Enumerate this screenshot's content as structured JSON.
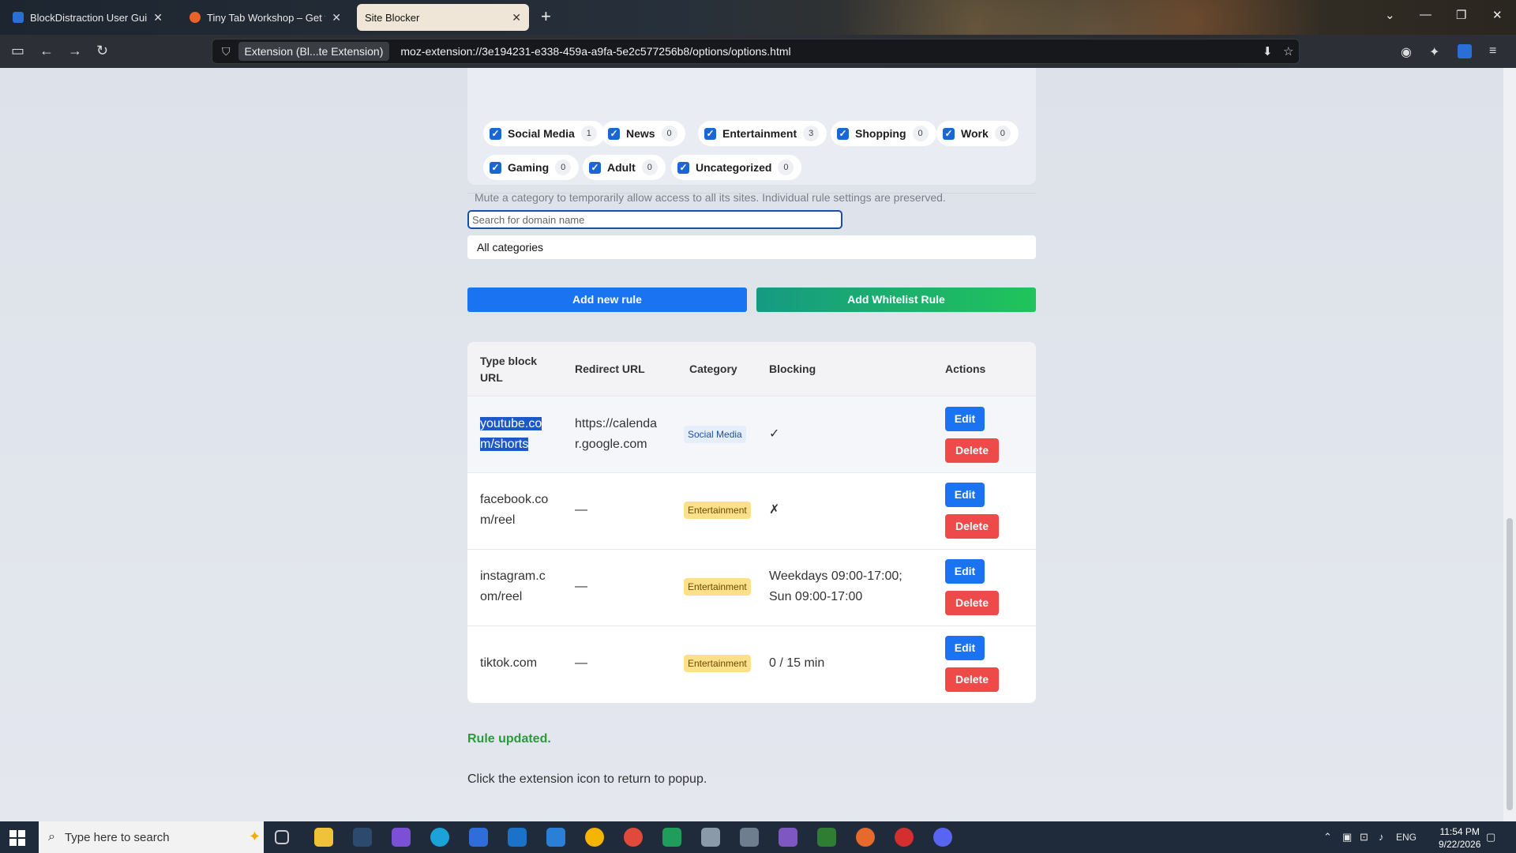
{
  "browser": {
    "tabs": [
      {
        "title": "BlockDistraction User Guide: Ru",
        "favicon_color": "#2a6fd6"
      },
      {
        "title": "Tiny Tab Workshop – Get this Th",
        "favicon_color": "#e8622a"
      },
      {
        "title": "Site Blocker",
        "favicon_color": "#f0e6d8"
      }
    ],
    "identity_chip": "Extension (Bl...te Extension)",
    "url": "moz-extension://3e194231-e338-459a-a9fa-5e2c577256b8/options/options.html"
  },
  "categories": {
    "items": [
      {
        "name": "Social Media",
        "count": "1",
        "checked": true
      },
      {
        "name": "News",
        "count": "0",
        "checked": true
      },
      {
        "name": "Entertainment",
        "count": "3",
        "checked": true
      },
      {
        "name": "Shopping",
        "count": "0",
        "checked": true
      },
      {
        "name": "Work",
        "count": "0",
        "checked": true
      },
      {
        "name": "Gaming",
        "count": "0",
        "checked": true
      },
      {
        "name": "Adult",
        "count": "0",
        "checked": true
      },
      {
        "name": "Uncategorized",
        "count": "0",
        "checked": true
      }
    ],
    "hint": "Mute a category to temporarily allow access to all its sites. Individual rule settings are preserved."
  },
  "filters": {
    "search_placeholder": "Search for domain name",
    "category_select": "All categories"
  },
  "actions": {
    "add_rule": "Add new rule",
    "add_whitelist": "Add Whitelist Rule"
  },
  "table": {
    "headers": {
      "url_line1": "Type block",
      "url_line2": "URL",
      "redirect": "Redirect URL",
      "category": "Category",
      "blocking": "Blocking",
      "actions": "Actions"
    },
    "rows": [
      {
        "url_1": "youtube.co",
        "url_2": "m/shorts",
        "redirect_1": "https://calenda",
        "redirect_2": "r.google.com",
        "category": "Social Media",
        "blocking_1": "✓",
        "blocking_2": "",
        "edit": "Edit",
        "delete": "Delete"
      },
      {
        "url_1": "facebook.co",
        "url_2": "m/reel",
        "redirect_1": "—",
        "redirect_2": "",
        "category": "Entertainment",
        "blocking_1": "✗",
        "blocking_2": "",
        "edit": "Edit",
        "delete": "Delete"
      },
      {
        "url_1": "instagram.c",
        "url_2": "om/reel",
        "redirect_1": "—",
        "redirect_2": "",
        "category": "Entertainment",
        "blocking_1": "Weekdays 09:00-17:00;",
        "blocking_2": "Sun 09:00-17:00",
        "edit": "Edit",
        "delete": "Delete"
      },
      {
        "url_1": "tiktok.com",
        "url_2": "",
        "redirect_1": "—",
        "redirect_2": "",
        "category": "Entertainment",
        "blocking_1": "0 / 15 min",
        "blocking_2": "",
        "edit": "Edit",
        "delete": "Delete"
      }
    ]
  },
  "status": "Rule updated.",
  "footnote": "Click the extension icon to return to popup.",
  "taskbar": {
    "search_placeholder": "Type here to search",
    "lang": "ENG",
    "time": "11:54 PM",
    "date": "9/22/2026"
  },
  "colors": {
    "primary": "#1a73f0",
    "danger": "#ef4a4a",
    "success": "#2a9a3a",
    "whitelist_start": "#169a82",
    "whitelist_end": "#20c45a"
  }
}
